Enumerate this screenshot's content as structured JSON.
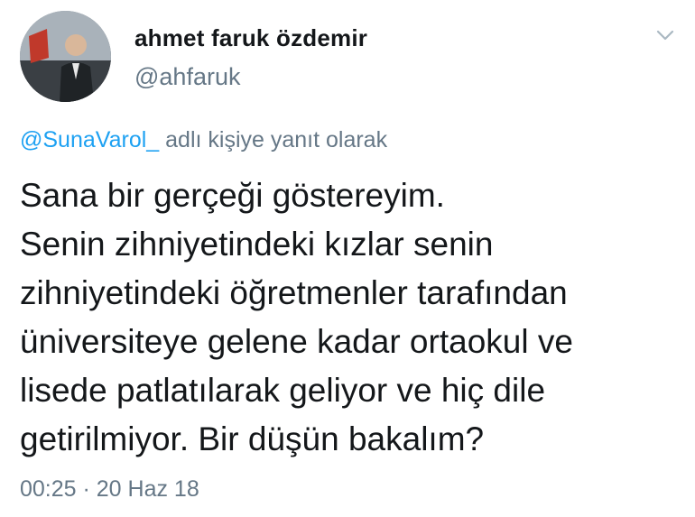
{
  "author": {
    "display_name": "ahmet faruk özdemir",
    "handle": "@ahfaruk"
  },
  "reply": {
    "mention": "@SunaVarol_",
    "suffix": " adlı kişiye yanıt olarak"
  },
  "tweet": {
    "lines": [
      "Sana bir gerçeği göstereyim.",
      "Senin zihniyetindeki kızlar senin",
      "zihniyetindeki öğretmenler tarafından",
      "üniversiteye gelene kadar ortaokul ve",
      "lisede patlatılarak geliyor ve hiç dile",
      "getirilmiyor. Bir düşün bakalım?"
    ]
  },
  "meta": {
    "timestamp": "00:25 · 20 Haz 18"
  },
  "icons": {
    "menu": "chevron-down-icon",
    "avatar": "profile-photo"
  },
  "colors": {
    "text": "#14171a",
    "secondary": "#657786",
    "link": "#1da1f2"
  }
}
